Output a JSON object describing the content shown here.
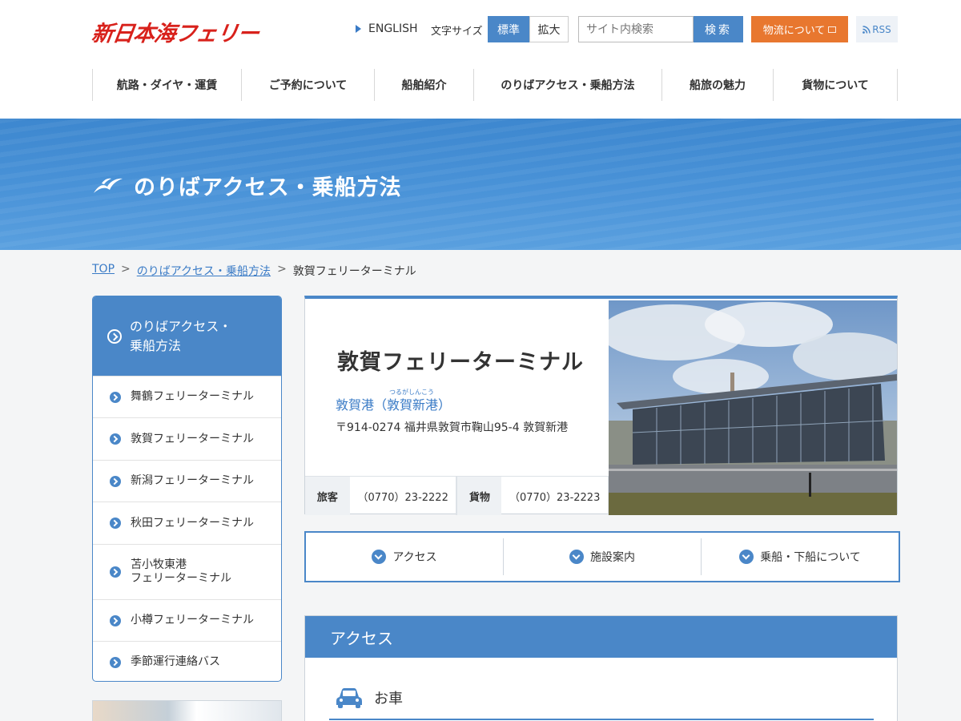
{
  "header": {
    "logo": "新日本海フェリー",
    "english_label": "ENGLISH",
    "font_size_label": "文字サイズ",
    "font_size_standard": "標準",
    "font_size_large": "拡大",
    "search_placeholder": "サイト内検索",
    "search_button": "検索",
    "logistics_button": "物流について",
    "rss_label": "RSS"
  },
  "global_nav": [
    {
      "label": "航路・ダイヤ・運賃"
    },
    {
      "label": "ご予約について"
    },
    {
      "label": "船舶紹介"
    },
    {
      "label": "のりばアクセス・乗船方法"
    },
    {
      "label": "船旅の魅力"
    },
    {
      "label": "貨物について"
    }
  ],
  "hero": {
    "title": "のりばアクセス・乗船方法"
  },
  "breadcrumb": {
    "home": "TOP",
    "section": "のりばアクセス・乗船方法",
    "current": "敦賀フェリーターミナル",
    "separator": ">"
  },
  "sidebar": {
    "heading": "のりばアクセス・\n乗船方法",
    "items": [
      {
        "label": "舞鶴フェリーターミナル"
      },
      {
        "label": "敦賀フェリーターミナル"
      },
      {
        "label": "新潟フェリーターミナル"
      },
      {
        "label": "秋田フェリーターミナル"
      },
      {
        "label": "苫小牧東港\nフェリーターミナル"
      },
      {
        "label": "小樽フェリーターミナル"
      },
      {
        "label": "季節運行連絡バス"
      }
    ]
  },
  "terminal": {
    "title": "敦賀フェリーターミナル",
    "port_ruby": "つるがしんこう",
    "port_name": "敦賀港（敦賀新港）",
    "address": "〒914-0274 福井県敦賀市鞠山95-4 敦賀新港",
    "passenger_label": "旅客",
    "passenger_tel": "（0770）23-2222",
    "cargo_label": "貨物",
    "cargo_tel": "（0770）23-2223"
  },
  "anchor_nav": [
    {
      "label": "アクセス"
    },
    {
      "label": "施設案内"
    },
    {
      "label": "乗船・下船について"
    }
  ],
  "access": {
    "heading": "アクセス",
    "car_label": "お車"
  },
  "colors": {
    "brand_red": "#d8211b",
    "primary_blue": "#4a87c8",
    "orange": "#e8772f"
  }
}
